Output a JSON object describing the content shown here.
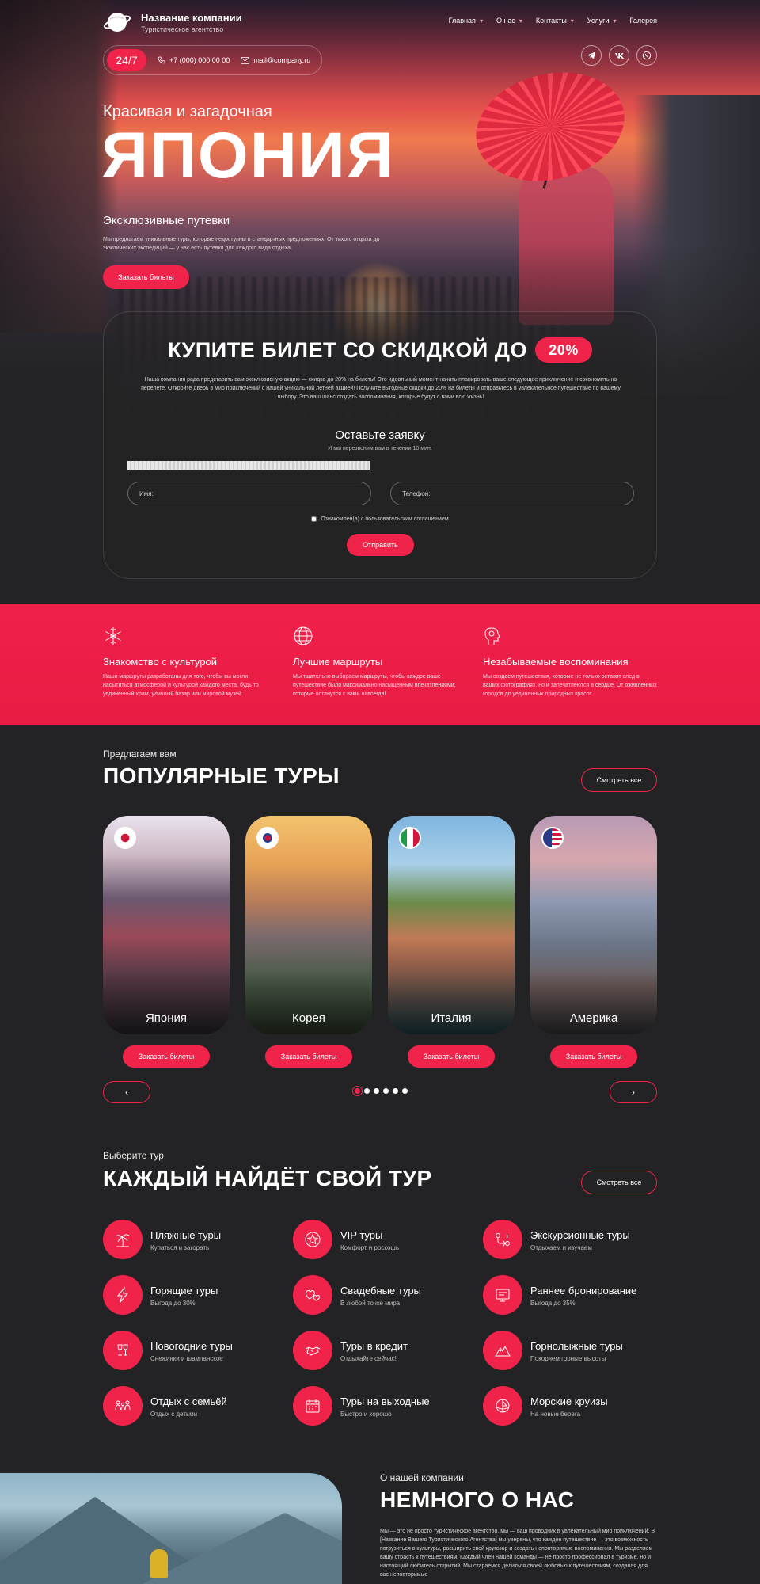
{
  "header": {
    "company_name": "Название компании",
    "company_sub": "Туристическое агентство",
    "nav": [
      {
        "label": "Главная",
        "dropdown": true
      },
      {
        "label": "О нас",
        "dropdown": true
      },
      {
        "label": "Контакты",
        "dropdown": true
      },
      {
        "label": "Услуги",
        "dropdown": true
      },
      {
        "label": "Галерея",
        "dropdown": false
      }
    ],
    "badge_247": "24/7",
    "phone": "+7 (000) 000 00 00",
    "email": "mail@company.ru",
    "socials": [
      "telegram-icon",
      "vk-icon",
      "whatsapp-icon"
    ]
  },
  "hero": {
    "kicker": "Красивая и загадочная",
    "title": "ЯПОНИЯ",
    "subtitle": "Эксклюзивные путевки",
    "desc": "Мы предлагаем уникальные туры, которые недоступны в стандартных предложениях. От тихого отдыха до экзотических экспедиций — у нас есть путевки для каждого вида отдыха.",
    "button": "Заказать билеты"
  },
  "promo": {
    "title": "КУПИТЕ БИЛЕТ СО СКИДКОЙ ДО",
    "badge": "20%",
    "desc": "Наша компания рада представить вам эксклюзивную акцию — скидка до 20% на билеты! Это идеальный момент начать планировать ваше следующее приключение и сэкономить на перелете. Откройте дверь в мир приключений с нашей уникальной летней акцией! Получите выгодные скидки до 20% на билеты и отправьтесь в увлекательное путешествие по вашему выбору. Это ваш шанс создать воспоминания, которые будут с вами всю жизнь!",
    "form_title": "Оставьте заявку",
    "form_sub": "И мы перезвоним вам в течении 10 мин.",
    "name_placeholder": "Имя:",
    "phone_placeholder": "Телефон:",
    "agree": "Ознакомлен(а) с пользовательским соглашением",
    "submit": "Отправить"
  },
  "features": [
    {
      "icon": "snowflake-icon",
      "title": "Знакомство с культурой",
      "text": "Наши маршруты разработаны для того, чтобы вы могли насытиться атмосферой и культурой каждого места, будь то уединенный храм, уличный базар или мировой музей."
    },
    {
      "icon": "globe-icon",
      "title": "Лучшие маршруты",
      "text": "Мы тщательно выбираем маршруты, чтобы каждое ваше путешествие было максимально насыщенным впечатлениями, которые останутся с вами навсегда!"
    },
    {
      "icon": "head-idea-icon",
      "title": "Незабываемые воспоминания",
      "text": "Мы создаем путешествия, которые не только оставят след в ваших фотографиях, но и запечатлеются в сердце. От оживленных городов до уединенных природных красот."
    }
  ],
  "popular": {
    "kicker": "Предлагаем вам",
    "title": "ПОПУЛЯРНЫЕ ТУРЫ",
    "see_all": "Смотреть все",
    "cards": [
      {
        "name": "Япония",
        "flag": "japan-flag-icon",
        "button": "Заказать билеты"
      },
      {
        "name": "Корея",
        "flag": "korea-flag-icon",
        "button": "Заказать билеты"
      },
      {
        "name": "Италия",
        "flag": "italy-flag-icon",
        "button": "Заказать билеты"
      },
      {
        "name": "Америка",
        "flag": "usa-flag-icon",
        "button": "Заказать билеты"
      }
    ],
    "prev": "‹",
    "next": "›",
    "dots_count": 6,
    "active_dot": 1
  },
  "tours": {
    "kicker": "Выберите тур",
    "title": "КАЖДЫЙ НАЙДЁТ СВОЙ ТУР",
    "see_all": "Смотреть все",
    "items": [
      {
        "name": "Пляжные туры",
        "sub": "Купаться и загорать",
        "icon": "palm-icon"
      },
      {
        "name": "VIP туры",
        "sub": "Комфорт и роскошь",
        "icon": "star-icon"
      },
      {
        "name": "Экскурсионные туры",
        "sub": "Отдыхаем и изучаем",
        "icon": "route-icon"
      },
      {
        "name": "Горящие туры",
        "sub": "Выгода до 30%",
        "icon": "lightning-icon"
      },
      {
        "name": "Свадебные туры",
        "sub": "В любой точке мира",
        "icon": "hearts-icon"
      },
      {
        "name": "Раннее бронирование",
        "sub": "Выгода до 35%",
        "icon": "calendar-screen-icon"
      },
      {
        "name": "Новогодние туры",
        "sub": "Снежинки и шампанское",
        "icon": "champagne-icon"
      },
      {
        "name": "Туры в кредит",
        "sub": "Отдыхайте сейчас!",
        "icon": "handshake-icon"
      },
      {
        "name": "Горнолыжные туры",
        "sub": "Покоряем горные высоты",
        "icon": "mountain-icon"
      },
      {
        "name": "Отдых с семьёй",
        "sub": "Отдых с детьми",
        "icon": "family-icon"
      },
      {
        "name": "Туры на выходные",
        "sub": "Быстро и хорошо",
        "icon": "calendar-icon"
      },
      {
        "name": "Морские круизы",
        "sub": "На новые берега",
        "icon": "ship-icon"
      }
    ]
  },
  "about": {
    "kicker": "О нашей компании",
    "title": "НЕМНОГО О НАС",
    "text": "Мы — это не просто туристическое агентство, мы — ваш проводник в увлекательный мир приключений. В [Название Вашего Туристического Агентства] мы уверены, что каждое путешествие — это возможность погрузиться в культуры, расширить свой кругозор и создать неповторимые воспоминания. Мы разделяем вашу страсть к путешествиям. Каждый член нашей команды — не просто профессионал в туризме, но и настоящий любитель открытий. Мы стараемся делиться своей любовью к путешествиям, создавая для вас неповторимые"
  },
  "colors": {
    "accent": "#f0244a",
    "background": "#232325"
  }
}
